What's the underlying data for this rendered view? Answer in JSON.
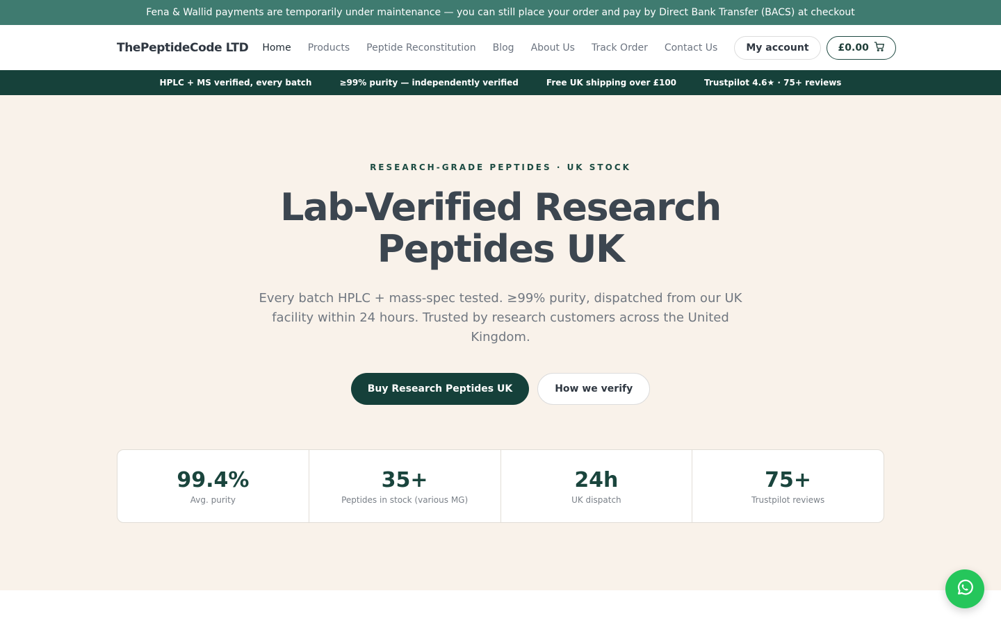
{
  "notice": "Fena & Wallid payments are temporarily under maintenance — you can still place your order and pay by Direct Bank Transfer (BACS) at checkout",
  "header": {
    "logo": "ThePeptideCode LTD",
    "nav": [
      "Home",
      "Products",
      "Peptide Reconstitution",
      "Blog",
      "About Us",
      "Track Order",
      "Contact Us"
    ],
    "active_nav": "Home",
    "account_label": "My account",
    "cart_total": "£0.00",
    "cart_icon": "cart-icon"
  },
  "trust_bar": [
    "HPLC + MS verified, every batch",
    "≥99% purity — independently verified",
    "Free UK shipping over £100",
    "Trustpilot 4.6★ · 75+ reviews"
  ],
  "hero": {
    "eyebrow": "RESEARCH-GRADE PEPTIDES · UK STOCK",
    "title_line1": "Lab-Verified Research",
    "title_line2": "Peptides UK",
    "subtitle": "Every batch HPLC + mass-spec tested. ≥99% purity, dispatched from our UK facility within 24 hours. Trusted by research customers across the United Kingdom.",
    "primary_cta": "Buy Research Peptides UK",
    "secondary_cta": "How we verify"
  },
  "stats": [
    {
      "value": "99.4%",
      "label": "Avg. purity"
    },
    {
      "value": "35+",
      "label": "Peptides in stock (various MG)"
    },
    {
      "value": "24h",
      "label": "UK dispatch"
    },
    {
      "value": "75+",
      "label": "Trustpilot reviews"
    }
  ],
  "floating": {
    "icon": "whatsapp-icon"
  },
  "colors": {
    "notice_bg": "#3f7b70",
    "trust_bg": "#16413a",
    "hero_bg": "#f9f2ea",
    "primary": "#15403a",
    "accent_text": "#1a453d",
    "whatsapp": "#25c65b"
  }
}
